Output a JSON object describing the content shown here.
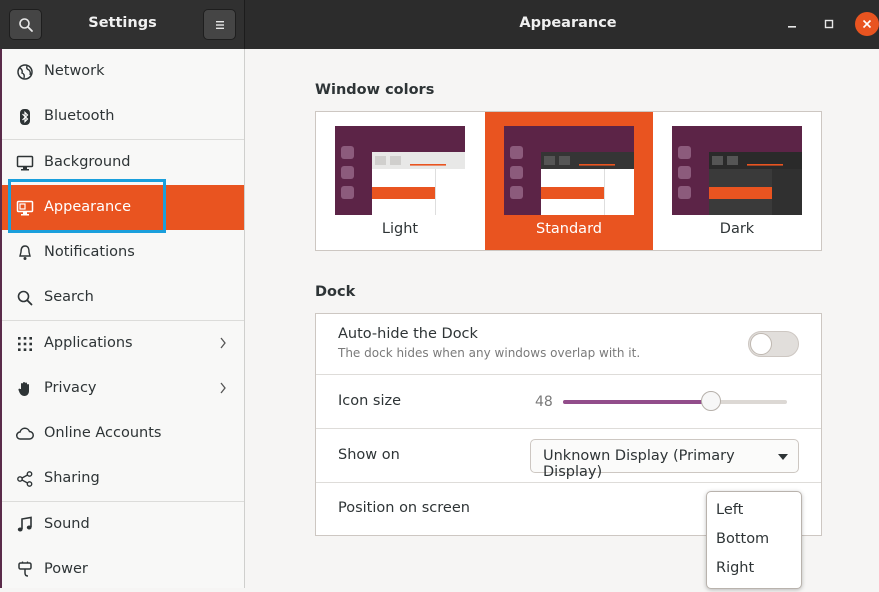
{
  "header": {
    "app_title": "Settings",
    "page_title": "Appearance",
    "search_icon": "search-icon",
    "menu_icon": "hamburger-menu-icon"
  },
  "sidebar": {
    "items": [
      {
        "label": "Network",
        "icon": "network-icon"
      },
      {
        "label": "Bluetooth",
        "icon": "bluetooth-icon"
      },
      {
        "label": "Background",
        "icon": "display-icon"
      },
      {
        "label": "Appearance",
        "icon": "appearance-icon",
        "active": true
      },
      {
        "label": "Notifications",
        "icon": "bell-icon"
      },
      {
        "label": "Search",
        "icon": "search-icon"
      },
      {
        "label": "Applications",
        "icon": "apps-grid-icon",
        "has_submenu": true
      },
      {
        "label": "Privacy",
        "icon": "hand-icon",
        "has_submenu": true
      },
      {
        "label": "Online Accounts",
        "icon": "cloud-icon"
      },
      {
        "label": "Sharing",
        "icon": "share-icon"
      },
      {
        "label": "Sound",
        "icon": "music-note-icon"
      },
      {
        "label": "Power",
        "icon": "power-icon"
      }
    ]
  },
  "window_colors": {
    "title": "Window colors",
    "options": [
      {
        "label": "Light",
        "selected": false
      },
      {
        "label": "Standard",
        "selected": true
      },
      {
        "label": "Dark",
        "selected": false
      }
    ]
  },
  "dock": {
    "title": "Dock",
    "auto_hide": {
      "label": "Auto-hide the Dock",
      "description": "The dock hides when any windows overlap with it.",
      "enabled": false
    },
    "icon_size": {
      "label": "Icon size",
      "value": "48",
      "fraction": 0.66
    },
    "show_on": {
      "label": "Show on",
      "value": "Unknown Display (Primary Display)"
    },
    "position": {
      "label": "Position on screen",
      "options": [
        "Left",
        "Bottom",
        "Right"
      ]
    }
  },
  "colors": {
    "accent": "#e95420",
    "slider_fill": "#924d8b",
    "header_bg": "#2c2c2c",
    "focus_outline": "#1a9fdc"
  }
}
